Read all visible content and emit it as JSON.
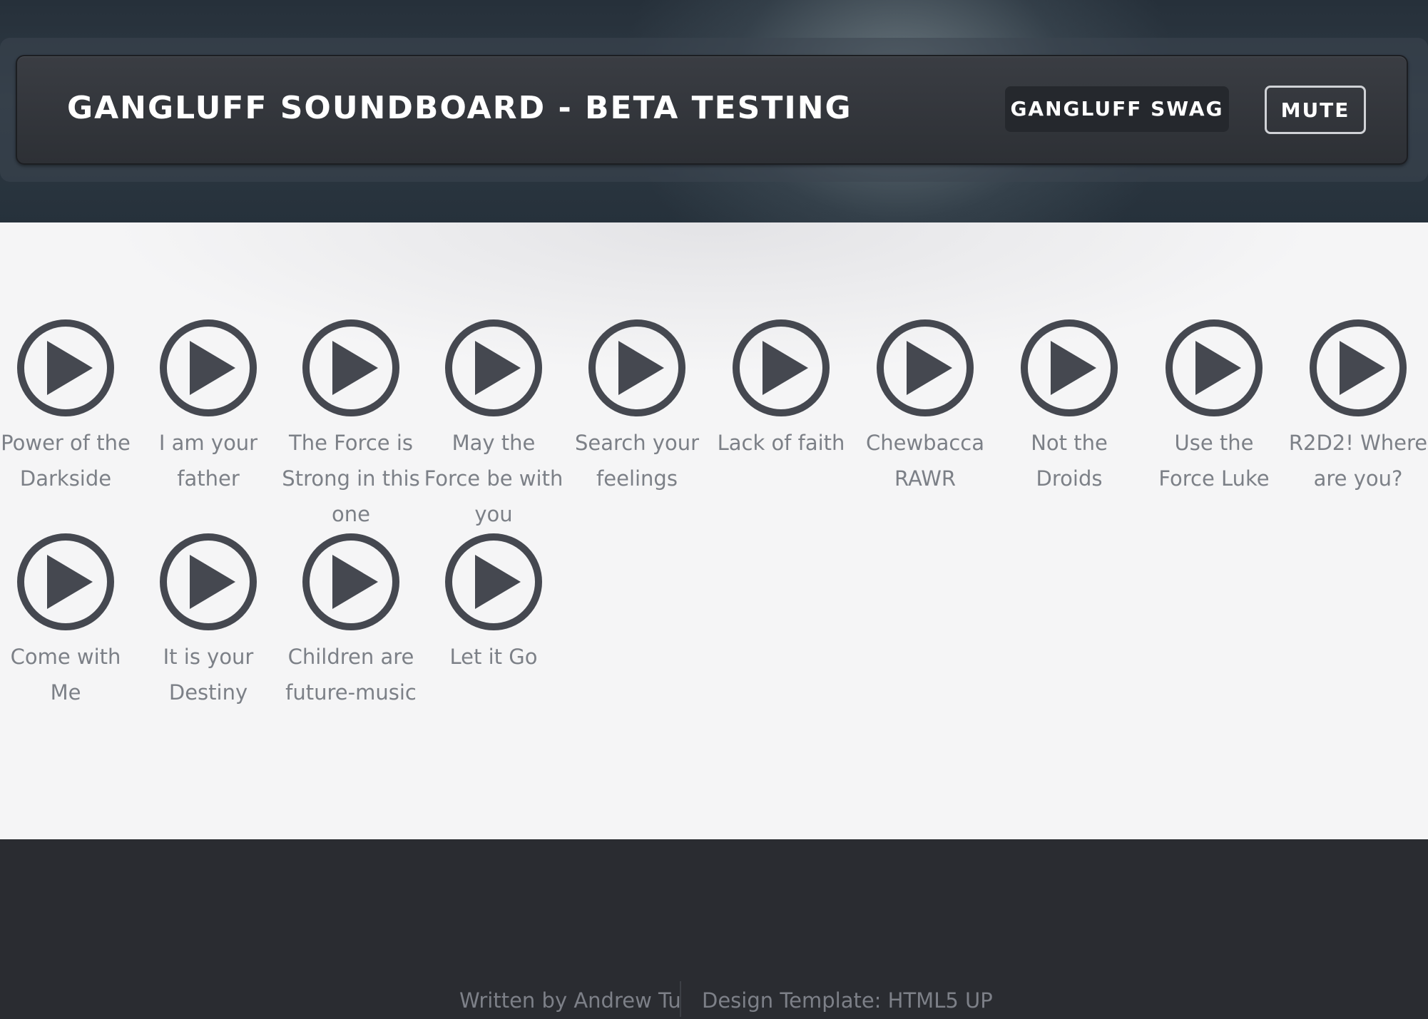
{
  "header": {
    "title": "GANGLUFF SOUNDBOARD - BETA TESTING",
    "swag_label": "GANGLUFF SWAG",
    "mute_label": "MUTE"
  },
  "sounds": [
    {
      "label": "Power of the Darkside",
      "icon": "play-circle-icon"
    },
    {
      "label": "I am your father",
      "icon": "play-circle-icon"
    },
    {
      "label": "The Force is Strong in this one",
      "icon": "play-circle-icon"
    },
    {
      "label": "May the Force be with you",
      "icon": "play-circle-icon"
    },
    {
      "label": "Search your feelings",
      "icon": "play-circle-icon"
    },
    {
      "label": "Lack of faith",
      "icon": "play-circle-icon"
    },
    {
      "label": "Chewbacca RAWR",
      "icon": "play-circle-icon"
    },
    {
      "label": "Not the Droids",
      "icon": "play-circle-icon"
    },
    {
      "label": "Use the Force Luke",
      "icon": "play-circle-icon"
    },
    {
      "label": "R2D2! Where are you?",
      "icon": "play-circle-icon"
    },
    {
      "label": "Come with Me",
      "icon": "play-circle-icon"
    },
    {
      "label": "It is your Destiny",
      "icon": "play-circle-icon"
    },
    {
      "label": "Children are future-music",
      "icon": "play-circle-icon"
    },
    {
      "label": "Let it Go",
      "icon": "play-circle-icon"
    }
  ],
  "footer": {
    "author": "Written by Andrew Tu",
    "template": "Design Template: HTML5 UP"
  },
  "colors": {
    "icon": "#454850",
    "label": "#7c8087",
    "footer_bg": "#2a2c31"
  }
}
